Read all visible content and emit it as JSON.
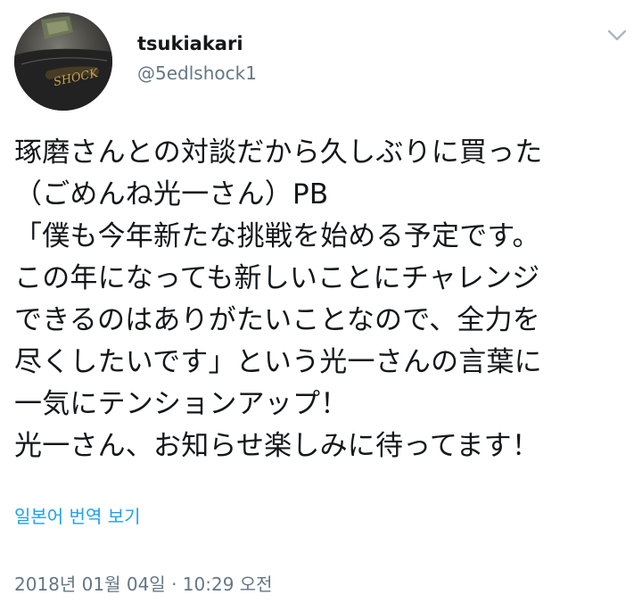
{
  "user": {
    "display_name": "tsukiakari",
    "handle": "@5edlshock1",
    "avatar_lettering": "SHOCK"
  },
  "icons": {
    "avatar": "avatar-image",
    "menu": "chevron-down-icon"
  },
  "tweet": {
    "lines": [
      "琢磨さんとの対談だから久しぶりに買った",
      "（ごめんね光一さん）PB",
      "「僕も今年新たな挑戦を始める予定です。",
      "この年になっても新しいことにチャレンジ",
      "できるのはありがたいことなので、全力を",
      "尽くしたいです」という光一さんの言葉に",
      "一気にテンションアップ！",
      "光一さん、お知らせ楽しみに待ってます！"
    ],
    "translate_label": "일본어 번역 보기",
    "timestamp": "2018년 01월 04일 · 10:29 오전"
  },
  "colors": {
    "text": "#14171a",
    "secondary": "#657786",
    "link": "#1da1f2",
    "chevron": "#aab8c2"
  }
}
